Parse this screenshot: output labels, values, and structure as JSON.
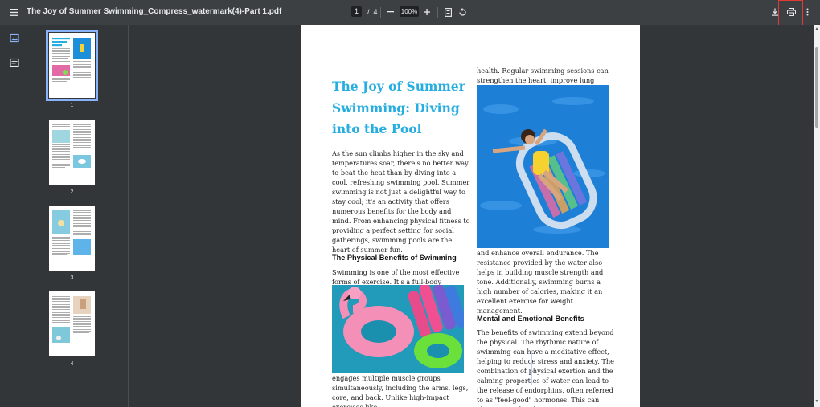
{
  "toolbar": {
    "title": "The Joy of Summer Swimming_Compress_watermark(4)-Part 1.pdf",
    "current_page": "1",
    "page_separator": "/",
    "total_pages": "4",
    "zoom": "100%"
  },
  "thumbnails": [
    {
      "num": "1",
      "selected": true
    },
    {
      "num": "2",
      "selected": false
    },
    {
      "num": "3",
      "selected": false
    },
    {
      "num": "4",
      "selected": false
    }
  ],
  "document": {
    "title": "The Joy of Summer Swimming: Diving into the Pool",
    "intro": "As the sun climbs higher in the sky and temperatures soar, there's no better way to beat the heat than by diving into a cool, refreshing swimming pool. Summer swimming is not just a delightful way to stay cool; it's an activity that offers numerous benefits for the body and mind. From enhancing physical fitness to providing a perfect setting for social gatherings, swimming pools are the heart of summer fun.",
    "physical_heading": "The Physical Benefits of Swimming",
    "physical_text_1": "Swimming is one of the most effective forms of exercise. It's a full-body workout that",
    "physical_text_2": "engages multiple muscle groups simultaneously, including the arms, legs, core, and back. Unlike high-impact exercises like",
    "col2_top": "health. Regular swimming sessions can strengthen the heart, improve lung capacity,",
    "col2_mid": "and enhance overall endurance. The resistance provided by the water also helps in building muscle strength and tone. Additionally, swimming burns a high number of calories, making it an excellent exercise for weight management.",
    "mental_heading": "Mental and Emotional Benefits",
    "mental_text": "The benefits of swimming extend beyond the physical. The rhythmic nature of swimming can have a meditative effect, helping to reduce stress and anxiety. The combination of physical exertion and the calming properties of water can lead to the release of endorphins, often referred to as \"feel-good\" hormones. This can elevate mood and"
  },
  "colors": {
    "accent": "#27aee0",
    "toolbar": "#3c4043",
    "highlight": "#e53935"
  }
}
